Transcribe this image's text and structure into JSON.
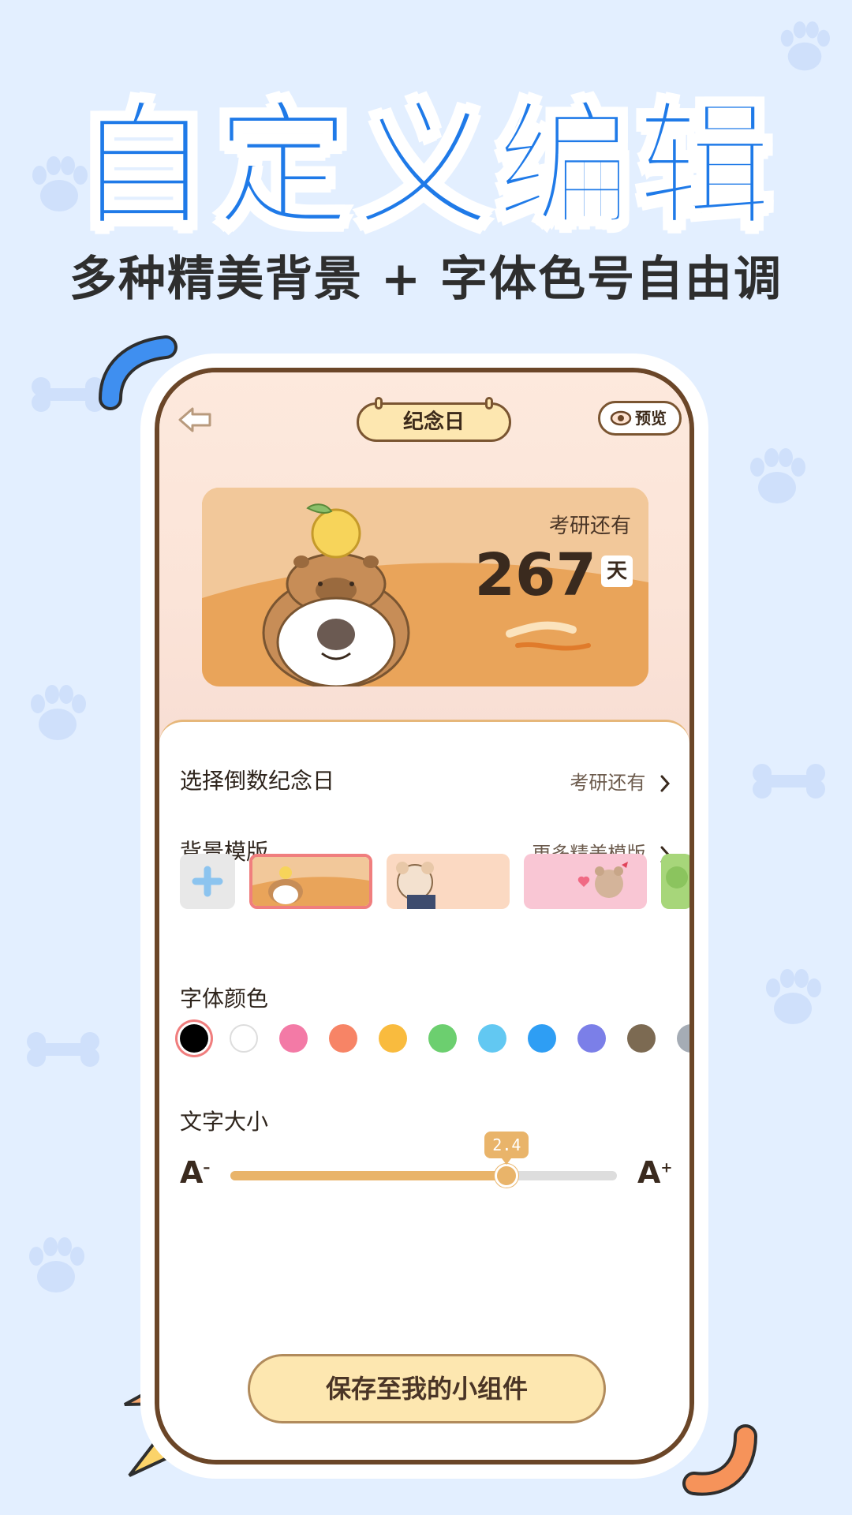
{
  "promo": {
    "headline": "自定义编辑",
    "subline": "多种精美背景 + 字体色号自由调"
  },
  "app": {
    "title": "纪念日",
    "preview_label": "预览",
    "widget": {
      "label": "考研还有",
      "days": "267",
      "unit": "天"
    },
    "settings": {
      "countdown_label": "选择倒数纪念日",
      "countdown_value": "考研还有",
      "template_label": "背景模版",
      "template_more": "更多精美模版",
      "font_color_label": "字体颜色",
      "font_colors": [
        "#000000",
        "#ffffff",
        "#f37aa6",
        "#f78466",
        "#f9bb3e",
        "#6ccf6f",
        "#62c8f2",
        "#2e9ef4",
        "#7b7fe8",
        "#7c6a52",
        "#a5acb5"
      ],
      "font_size_label": "文字大小",
      "font_size_value": "2.4",
      "font_size_fraction": 0.715,
      "a_minus": "A",
      "a_plus": "A"
    },
    "save_label": "保存至我的小组件"
  }
}
